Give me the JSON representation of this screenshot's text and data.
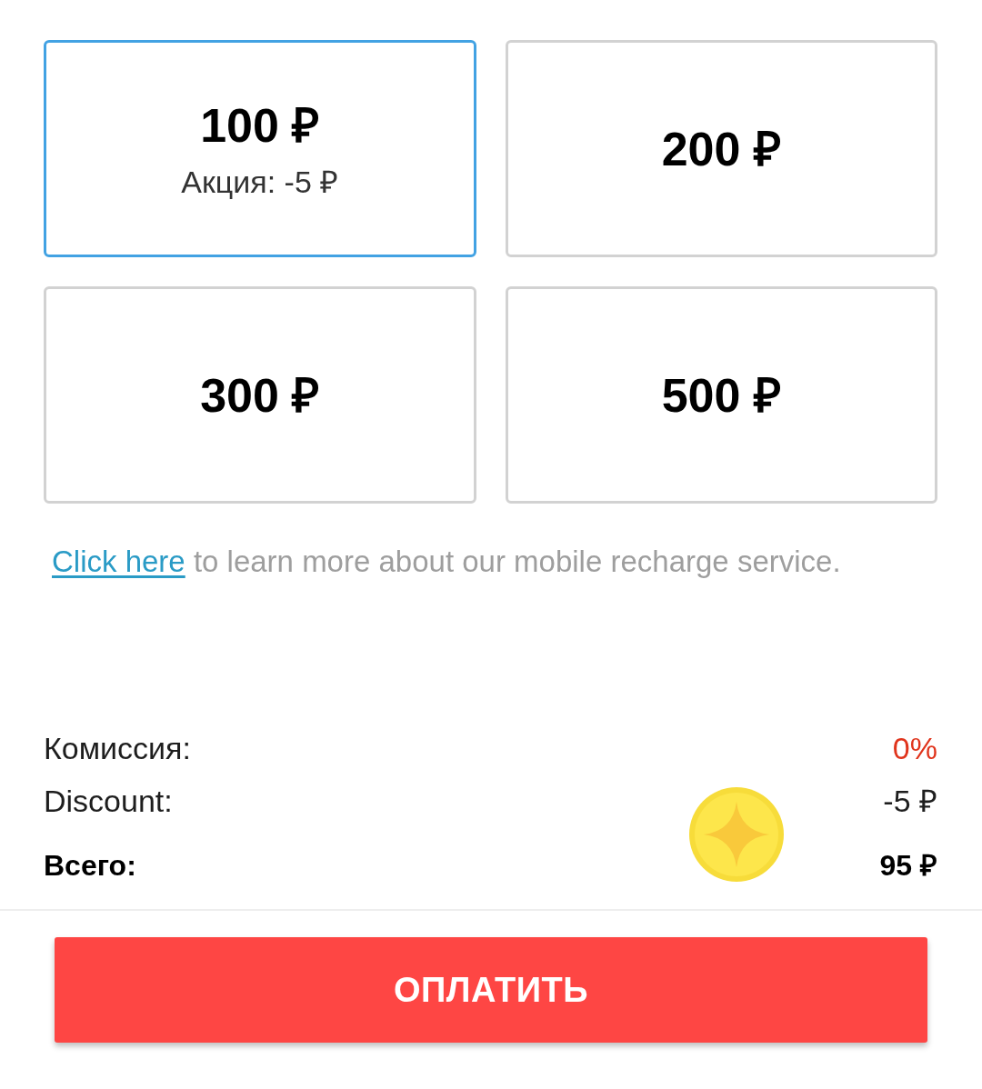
{
  "amount_options": [
    {
      "amount": "100 ₽",
      "promo": "Акция: -5 ₽",
      "selected": true
    },
    {
      "amount": "200 ₽",
      "selected": false
    },
    {
      "amount": "300 ₽",
      "selected": false
    },
    {
      "amount": "500 ₽",
      "selected": false
    }
  ],
  "info_text": {
    "link": "Click here",
    "text": "to learn more about our mobile recharge service."
  },
  "summary": [
    {
      "kind": "commission",
      "label": "Комиссия:",
      "value": "0%"
    },
    {
      "kind": "discount",
      "label": "Discount:",
      "value": "-5 ₽"
    },
    {
      "kind": "total",
      "label": "Всего:",
      "value": "95 ₽"
    }
  ],
  "pay_button": {
    "label": "ОПЛАТИТЬ"
  }
}
